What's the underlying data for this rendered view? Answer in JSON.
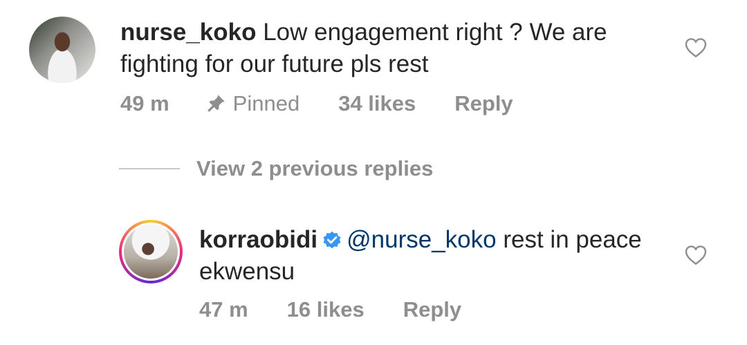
{
  "comments": [
    {
      "username": "nurse_koko",
      "text": " Low engagement right ? We are fighting for our future pls rest",
      "time": "49 m",
      "pinned_label": "Pinned",
      "likes": "34 likes",
      "reply": "Reply"
    },
    {
      "username": "korraobidi",
      "mention": "@nurse_koko",
      "text": " rest in peace ekwensu",
      "time": "47 m",
      "likes": "16 likes",
      "reply": "Reply"
    }
  ],
  "replies_toggle": {
    "label": "View 2 previous replies"
  },
  "colors": {
    "text": "#262626",
    "muted": "#8e8e8e",
    "mention": "#00376b",
    "verified": "#3897f0"
  },
  "icons": [
    "heart-icon",
    "pin-icon",
    "verified-badge-icon"
  ]
}
